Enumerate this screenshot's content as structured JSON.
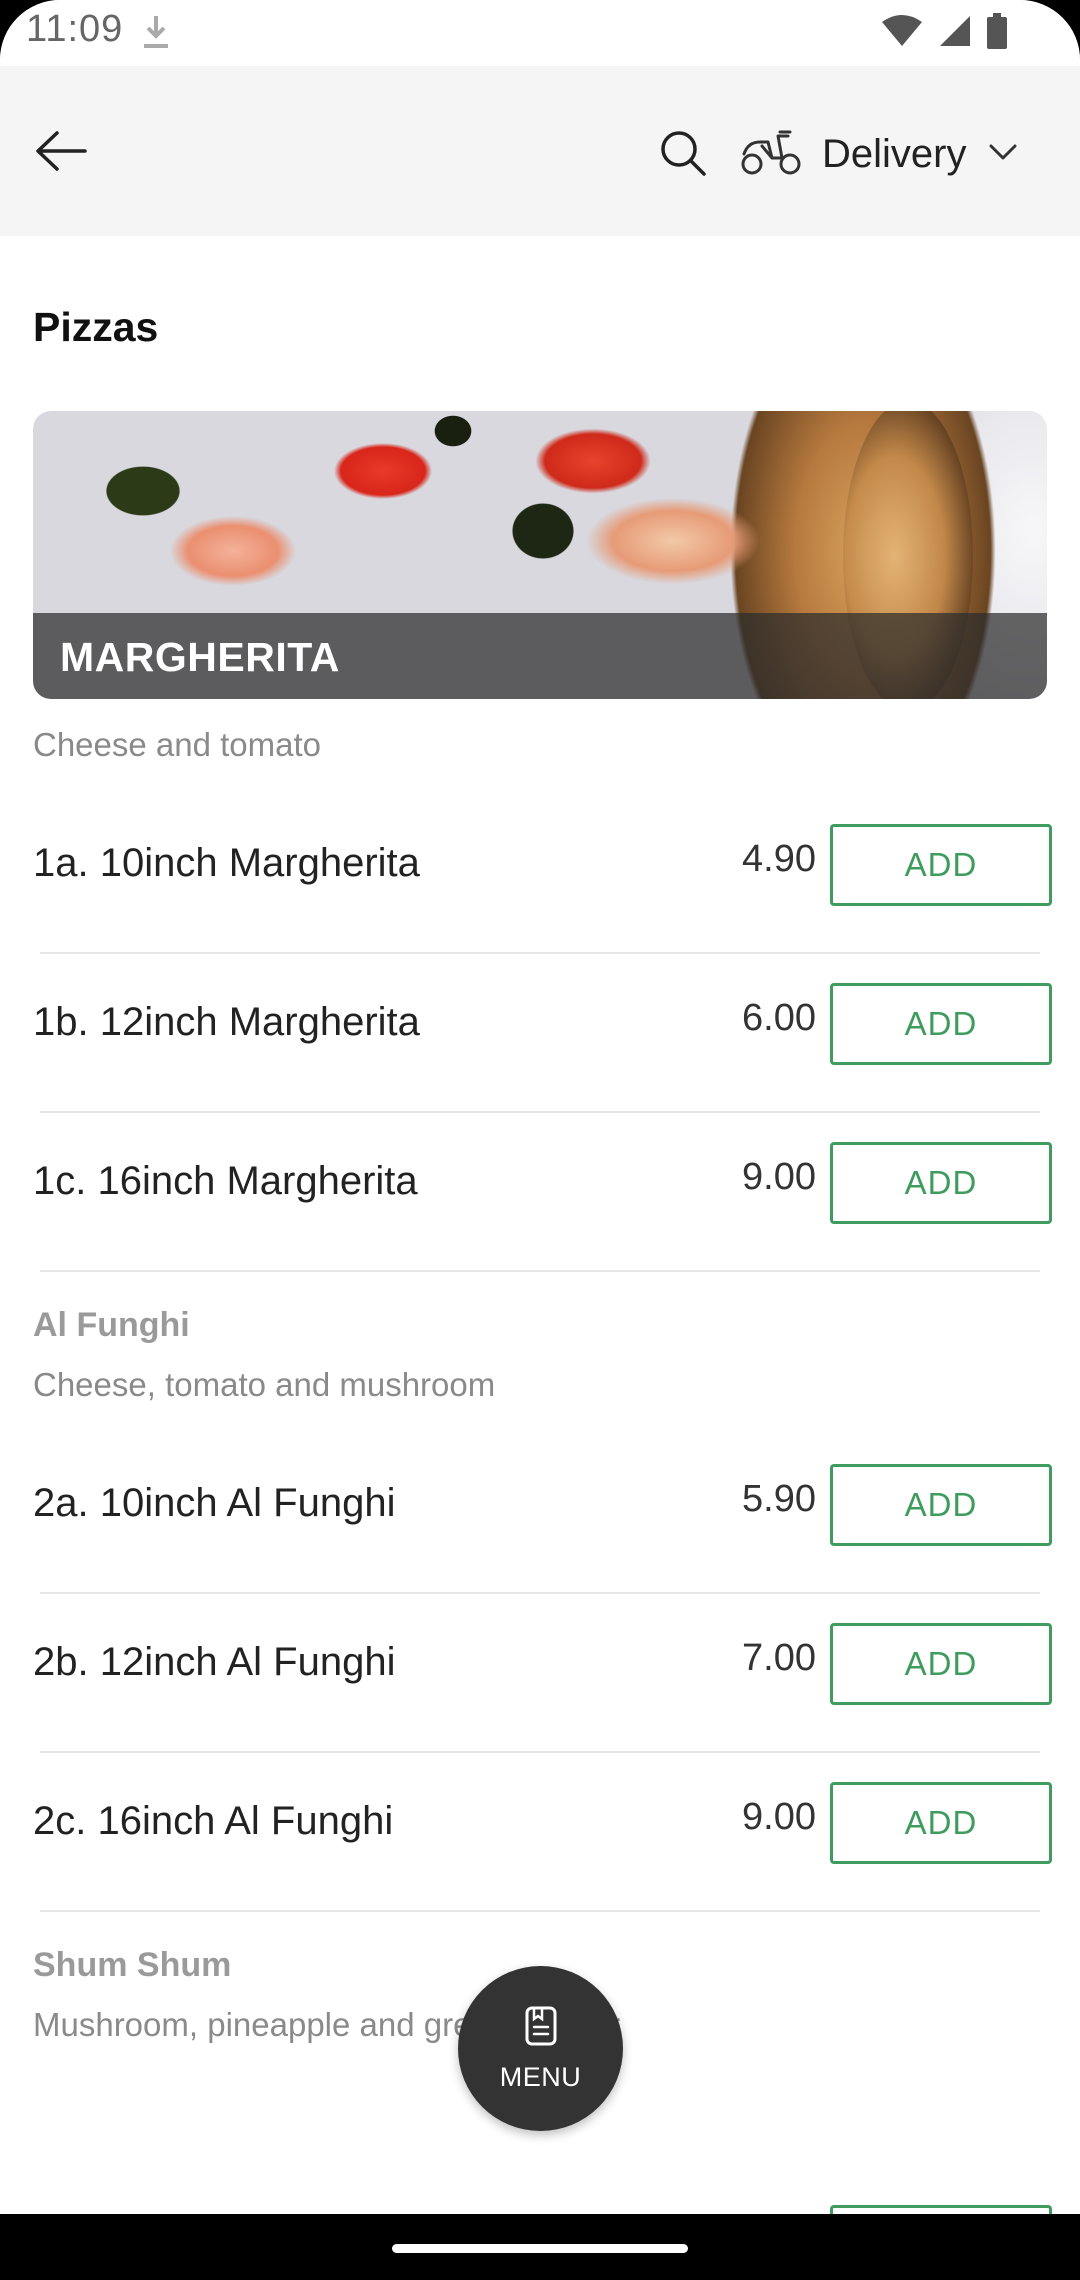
{
  "status_bar": {
    "time": "11:09"
  },
  "app_bar": {
    "delivery_label": "Delivery"
  },
  "section": {
    "title": "Pizzas"
  },
  "hero": {
    "label": "MARGHERITA"
  },
  "groups": [
    {
      "description": "Cheese and tomato",
      "items": [
        {
          "name": "1a. 10inch Margherita",
          "price": "4.90",
          "button": "ADD"
        },
        {
          "name": "1b. 12inch Margherita",
          "price": "6.00",
          "button": "ADD"
        },
        {
          "name": "1c. 16inch Margherita",
          "price": "9.00",
          "button": "ADD"
        }
      ]
    },
    {
      "name": "Al Funghi",
      "description": "Cheese, tomato and mushroom",
      "items": [
        {
          "name": "2a. 10inch Al Funghi",
          "price": "5.90",
          "button": "ADD"
        },
        {
          "name": "2b. 12inch Al Funghi",
          "price": "7.00",
          "button": "ADD"
        },
        {
          "name": "2c. 16inch Al Funghi",
          "price": "9.00",
          "button": "ADD"
        }
      ]
    },
    {
      "name": "Shum Shum",
      "description": "Mushroom, pineapple and green pepper"
    }
  ],
  "fab": {
    "label": "MENU"
  },
  "colors": {
    "accent_green": "#3f9b5e",
    "app_bar_bg": "#f5f5f5",
    "fab_bg": "#333333"
  },
  "icons": [
    "download-icon",
    "wifi-icon",
    "signal-icon",
    "battery-icon",
    "back-arrow-icon",
    "search-icon",
    "scooter-icon",
    "chevron-down-icon",
    "menu-book-icon"
  ]
}
